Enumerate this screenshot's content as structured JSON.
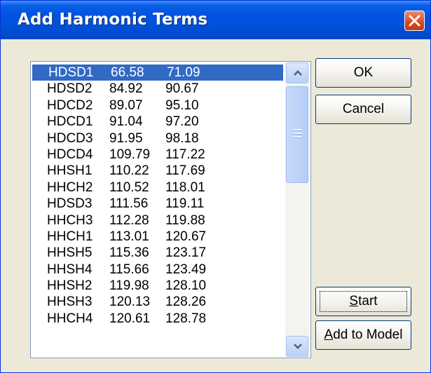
{
  "dialog": {
    "title": "Add Harmonic Terms"
  },
  "list": {
    "selected_index": 0,
    "rows": [
      {
        "name": "HDSD1",
        "v1": "66.58",
        "v2": "71.09"
      },
      {
        "name": "HDSD2",
        "v1": "84.92",
        "v2": "90.67"
      },
      {
        "name": "HDCD2",
        "v1": "89.07",
        "v2": "95.10"
      },
      {
        "name": "HDCD1",
        "v1": "91.04",
        "v2": "97.20"
      },
      {
        "name": "HDCD3",
        "v1": "91.95",
        "v2": "98.18"
      },
      {
        "name": "HDCD4",
        "v1": "109.79",
        "v2": "117.22"
      },
      {
        "name": "HHSH1",
        "v1": "110.22",
        "v2": "117.69"
      },
      {
        "name": "HHCH2",
        "v1": "110.52",
        "v2": "118.01"
      },
      {
        "name": "HDSD3",
        "v1": "111.56",
        "v2": "119.11"
      },
      {
        "name": "HHCH3",
        "v1": "112.28",
        "v2": "119.88"
      },
      {
        "name": "HHCH1",
        "v1": "113.01",
        "v2": "120.67"
      },
      {
        "name": "HHSH5",
        "v1": "115.36",
        "v2": "123.17"
      },
      {
        "name": "HHSH4",
        "v1": "115.66",
        "v2": "123.49"
      },
      {
        "name": "HHSH2",
        "v1": "119.98",
        "v2": "128.10"
      },
      {
        "name": "HHSH3",
        "v1": "120.13",
        "v2": "128.26"
      },
      {
        "name": "HHCH4",
        "v1": "120.61",
        "v2": "128.78"
      },
      {
        "name": "",
        "v1": "",
        "v2": ""
      }
    ]
  },
  "buttons": {
    "ok": "OK",
    "cancel": "Cancel",
    "start_mnemonic": "S",
    "start_rest": "tart",
    "add_mnemonic": "A",
    "add_rest": "dd to Model"
  },
  "icons": {
    "close": "close-icon",
    "scroll_up": "chevron-up-icon",
    "scroll_down": "chevron-down-icon"
  },
  "colors": {
    "title_bar": "#0052e0",
    "selection": "#316ac5",
    "close_button": "#d9461f",
    "dialog_face": "#ece9d8"
  }
}
